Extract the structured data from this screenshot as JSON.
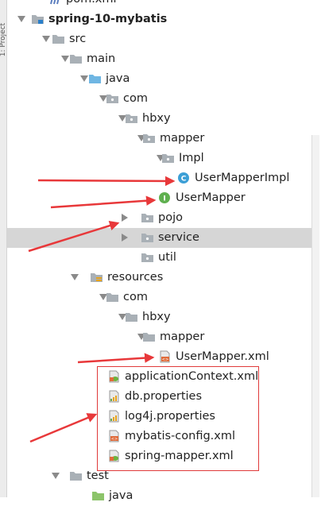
{
  "side_panel": {
    "label": "1: Project"
  },
  "tree": {
    "rows": [
      {
        "label": "pom.xml",
        "icon": "maven-file-icon",
        "arrow": "none",
        "bold": false
      },
      {
        "label": "spring-10-mybatis",
        "icon": "module-folder-icon",
        "arrow": "down",
        "bold": true
      },
      {
        "label": "src",
        "icon": "folder-icon",
        "arrow": "down",
        "bold": false
      },
      {
        "label": "main",
        "icon": "folder-icon",
        "arrow": "down",
        "bold": false
      },
      {
        "label": "java",
        "icon": "source-root-folder-icon",
        "arrow": "down",
        "bold": false
      },
      {
        "label": "com",
        "icon": "package-icon",
        "arrow": "down",
        "bold": false
      },
      {
        "label": "hbxy",
        "icon": "package-icon",
        "arrow": "down",
        "bold": false
      },
      {
        "label": "mapper",
        "icon": "package-icon",
        "arrow": "down",
        "bold": false
      },
      {
        "label": "Impl",
        "icon": "package-icon",
        "arrow": "down",
        "bold": false
      },
      {
        "label": "UserMapperImpl",
        "icon": "class-icon",
        "arrow": "none",
        "bold": false
      },
      {
        "label": "UserMapper",
        "icon": "interface-icon",
        "arrow": "none",
        "bold": false
      },
      {
        "label": "pojo",
        "icon": "package-icon",
        "arrow": "right",
        "bold": false
      },
      {
        "label": "service",
        "icon": "package-icon",
        "arrow": "right",
        "bold": false
      },
      {
        "label": "util",
        "icon": "package-icon",
        "arrow": "none",
        "bold": false
      },
      {
        "label": "resources",
        "icon": "resources-folder-icon",
        "arrow": "down",
        "bold": false
      },
      {
        "label": "com",
        "icon": "folder-icon",
        "arrow": "down",
        "bold": false
      },
      {
        "label": "hbxy",
        "icon": "folder-icon",
        "arrow": "down",
        "bold": false
      },
      {
        "label": "mapper",
        "icon": "folder-icon",
        "arrow": "down",
        "bold": false
      },
      {
        "label": "UserMapper.xml",
        "icon": "xml-file-icon",
        "arrow": "none",
        "bold": false
      },
      {
        "label": "applicationContext.xml",
        "icon": "spring-xml-icon",
        "arrow": "none",
        "bold": false
      },
      {
        "label": "db.properties",
        "icon": "properties-file-icon",
        "arrow": "none",
        "bold": false
      },
      {
        "label": "log4j.properties",
        "icon": "properties-file-icon",
        "arrow": "none",
        "bold": false
      },
      {
        "label": "mybatis-config.xml",
        "icon": "xml-file-icon",
        "arrow": "none",
        "bold": false
      },
      {
        "label": "spring-mapper.xml",
        "icon": "spring-xml-icon",
        "arrow": "none",
        "bold": false
      },
      {
        "label": "test",
        "icon": "folder-icon",
        "arrow": "down",
        "bold": false
      },
      {
        "label": "java",
        "icon": "test-root-folder-icon",
        "arrow": "none",
        "bold": false
      }
    ],
    "selected_label": "service"
  },
  "colors": {
    "selection": "#d6d6d6",
    "annotation": "#e8383a",
    "folder": "#a9b0b6",
    "source_root": "#6fb6e3",
    "class": "#3c9fd6",
    "interface": "#5fb04f",
    "xml": "#e06b3a",
    "properties": "#e7a31b"
  }
}
